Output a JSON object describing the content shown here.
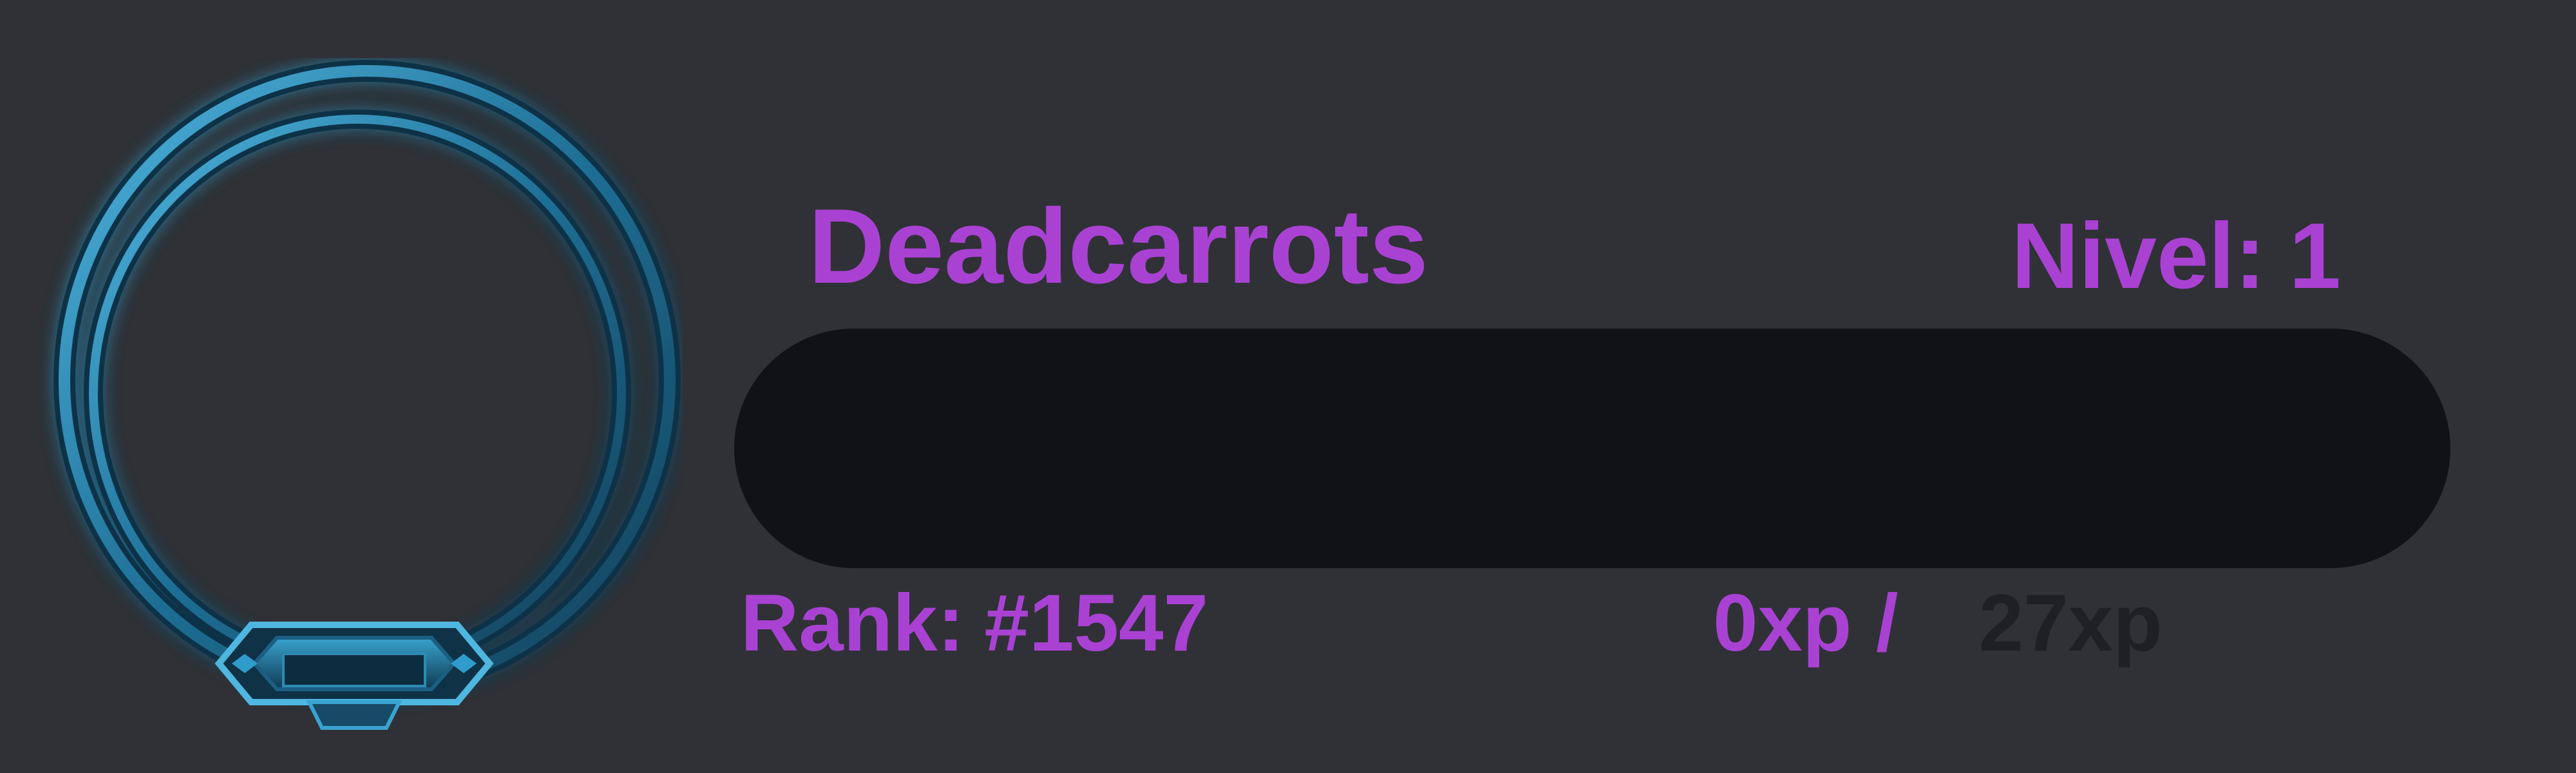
{
  "profile": {
    "username": "Deadcarrots",
    "level_label": "Nivel:",
    "level_value": "1",
    "rank_label": "Rank:",
    "rank_value": "#1547",
    "xp_current": "0xp",
    "xp_separator": "/",
    "xp_total": "27xp",
    "xp_progress_fraction": 0,
    "avatar_icon": "avatar-frame-icon"
  },
  "colors": {
    "background": "#2f3136",
    "accent": "#a942d3",
    "track": "#111215",
    "xp_total_text": "#1f2024",
    "frame_blue": "#2a8fbd"
  }
}
